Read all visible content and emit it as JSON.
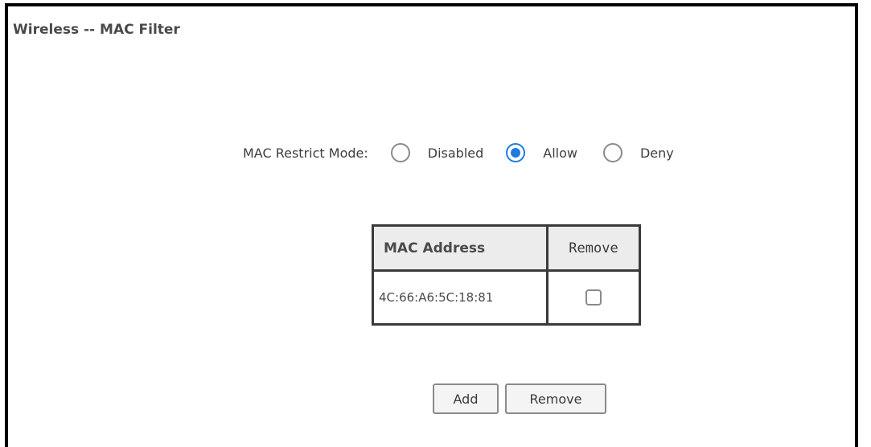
{
  "page": {
    "title": "Wireless -- MAC Filter"
  },
  "restrict_mode": {
    "label": "MAC Restrict Mode:",
    "options": [
      {
        "label": "Disabled",
        "checked": false
      },
      {
        "label": "Allow",
        "checked": true
      },
      {
        "label": "Deny",
        "checked": false
      }
    ],
    "selected": "Allow"
  },
  "table": {
    "headers": [
      "MAC Address",
      "Remove"
    ],
    "rows": [
      {
        "mac": "4C:66:A6:5C:18:81",
        "remove_checked": false
      }
    ]
  },
  "buttons": {
    "add_label": "Add",
    "remove_label": "Remove"
  },
  "colors": {
    "accent": "#1f7ae0",
    "border": "#3a3a3a",
    "header_bg": "#ececec"
  }
}
